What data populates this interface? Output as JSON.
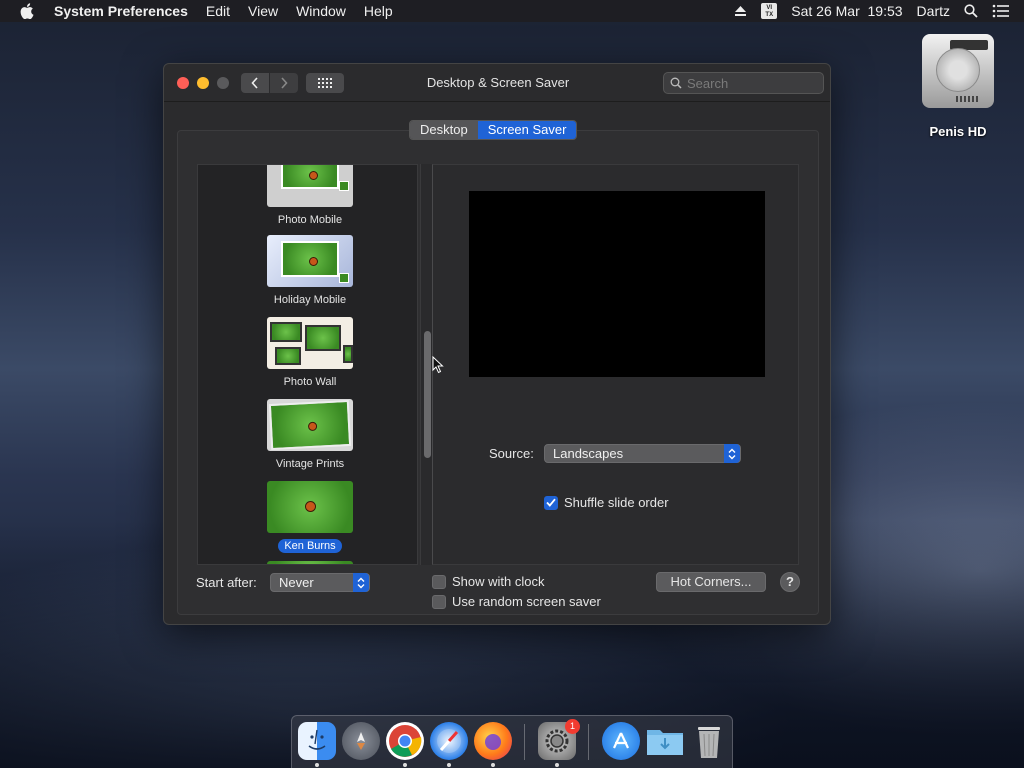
{
  "menubar": {
    "app_name": "System Preferences",
    "menus": [
      "Edit",
      "View",
      "Window",
      "Help"
    ],
    "datetime": "Sat 26 Mar  19:53",
    "user": "Dartz",
    "input_source": "VI\nTX"
  },
  "desktop": {
    "disk_name": "Penis HD"
  },
  "window": {
    "title": "Desktop & Screen Saver",
    "search_placeholder": "Search",
    "tabs": [
      {
        "label": "Desktop",
        "active": false
      },
      {
        "label": "Screen Saver",
        "active": true
      }
    ]
  },
  "savers": [
    {
      "label": "Photo Mobile",
      "selected": false
    },
    {
      "label": "Holiday Mobile",
      "selected": false
    },
    {
      "label": "Photo Wall",
      "selected": false
    },
    {
      "label": "Vintage Prints",
      "selected": false
    },
    {
      "label": "Ken Burns",
      "selected": true
    }
  ],
  "options": {
    "source_label": "Source:",
    "source_value": "Landscapes",
    "shuffle_label": "Shuffle slide order",
    "shuffle_checked": true
  },
  "footer": {
    "start_after_label": "Start after:",
    "start_after_value": "Never",
    "show_clock_label": "Show with clock",
    "show_clock_checked": false,
    "random_label": "Use random screen saver",
    "random_checked": false,
    "hot_corners_label": "Hot Corners...",
    "help_label": "?"
  },
  "dock": {
    "items": [
      {
        "icon": "finder-icon",
        "running": true
      },
      {
        "icon": "launchpad-icon",
        "running": false
      },
      {
        "icon": "chrome-icon",
        "running": true
      },
      {
        "icon": "safari-icon",
        "running": true
      },
      {
        "icon": "firefox-icon",
        "running": true
      },
      {
        "icon": "system-preferences-icon",
        "running": true,
        "badge": "1"
      },
      {
        "icon": "app-store-icon",
        "running": false
      },
      {
        "icon": "downloads-folder-icon",
        "running": false
      },
      {
        "icon": "trash-icon",
        "running": false
      }
    ]
  },
  "colors": {
    "accent": "#1f63d6",
    "close": "#ff5f57",
    "minimize": "#ffbd2e",
    "badge": "#f23b30"
  }
}
